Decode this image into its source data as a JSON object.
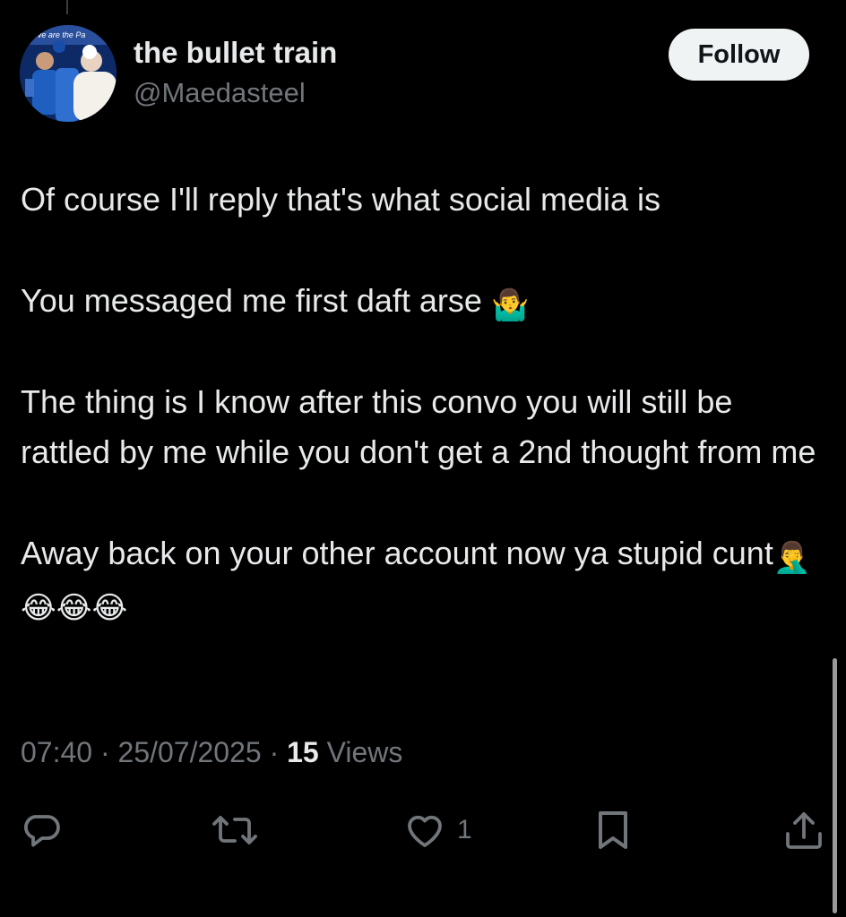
{
  "post": {
    "author": {
      "display_name": "the bullet train",
      "handle": "@Maedasteel",
      "avatar_caption": "We are the Pa"
    },
    "follow_label": "Follow",
    "body": {
      "p1": "Of course I'll reply that's what social media is",
      "p2": "You messaged me first daft arse",
      "p2_emoji": "🤷‍♂️",
      "p3": "The thing is I know after this convo you will still be rattled by me while you don't get a 2nd thought from me",
      "p4": "Away back on your other account now ya stupid cunt",
      "p4_emoji_1": "🤦‍♂️",
      "p4_emoji_2": "😂😂😂"
    },
    "meta": {
      "time": "07:40",
      "separator": " · ",
      "date": "25/07/2025",
      "views_count": "15",
      "views_label": "Views"
    },
    "actions": {
      "reply_icon": "reply-icon",
      "repost_icon": "repost-icon",
      "like_icon": "heart-icon",
      "like_count": "1",
      "bookmark_icon": "bookmark-icon",
      "share_icon": "share-icon"
    }
  },
  "colors": {
    "background": "#000000",
    "text_primary": "#e7e9ea",
    "text_secondary": "#71767b",
    "follow_button_bg": "#eff3f4",
    "follow_button_text": "#0f1419"
  }
}
